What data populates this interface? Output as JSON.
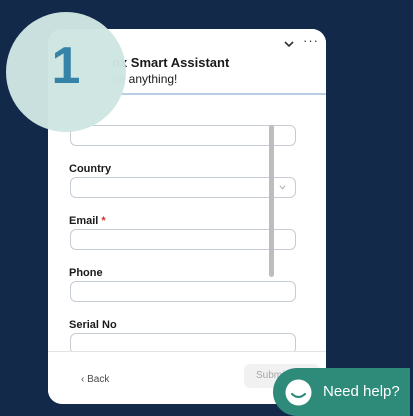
{
  "header": {
    "title": "ox Smart Assistant",
    "subtitle": "ne anything!",
    "more_label": "···"
  },
  "form": {
    "fields": [
      {
        "label": ""
      },
      {
        "label": "Country",
        "value": ""
      },
      {
        "label": "Email",
        "required_mark": "*",
        "value": ""
      },
      {
        "label": "Phone",
        "value": ""
      },
      {
        "label": "Serial No",
        "value": ""
      }
    ]
  },
  "footer": {
    "back_label": "‹ Back",
    "submit_label": "Submit"
  },
  "step_badge": {
    "number": "1"
  },
  "help": {
    "label": "Need help?"
  },
  "colors": {
    "page_bg": "#13294a",
    "accent_teal": "#2e8b7a",
    "step_circle": "#cfe6e3",
    "step_number": "#2f7fa5",
    "required": "#d42e2e"
  }
}
